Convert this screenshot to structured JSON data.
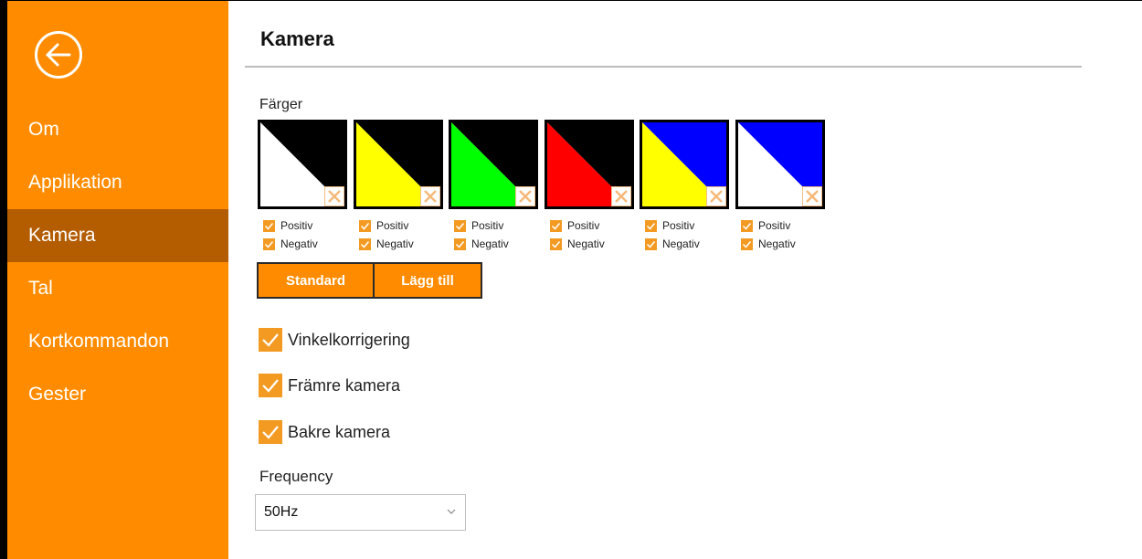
{
  "sidebar": {
    "back_icon": "back-arrow-circle-icon",
    "items": [
      {
        "label": "Om",
        "active": false
      },
      {
        "label": "Applikation",
        "active": false
      },
      {
        "label": "Kamera",
        "active": true
      },
      {
        "label": "Tal",
        "active": false
      },
      {
        "label": "Kortkommandon",
        "active": false
      },
      {
        "label": "Gester",
        "active": false
      }
    ],
    "color": "#ff8c00",
    "active_color": "#b35c00"
  },
  "page": {
    "title": "Kamera"
  },
  "colors_section": {
    "label": "Färger",
    "swatches": [
      {
        "top": "#000000",
        "bottom": "#ffffff",
        "positive": "Positiv",
        "negative": "Negativ",
        "positive_checked": true,
        "negative_checked": true
      },
      {
        "top": "#000000",
        "bottom": "#ffff00",
        "positive": "Positiv",
        "negative": "Negativ",
        "positive_checked": true,
        "negative_checked": true
      },
      {
        "top": "#000000",
        "bottom": "#00ff00",
        "positive": "Positiv",
        "negative": "Negativ",
        "positive_checked": true,
        "negative_checked": true
      },
      {
        "top": "#000000",
        "bottom": "#ff0000",
        "positive": "Positiv",
        "negative": "Negativ",
        "positive_checked": true,
        "negative_checked": true
      },
      {
        "top": "#0000ff",
        "bottom": "#ffff00",
        "positive": "Positiv",
        "negative": "Negativ",
        "positive_checked": true,
        "negative_checked": true
      },
      {
        "top": "#0000ff",
        "bottom": "#ffffff",
        "positive": "Positiv",
        "negative": "Negativ",
        "positive_checked": true,
        "negative_checked": true
      }
    ],
    "delete_icon": "close-x-icon"
  },
  "buttons": {
    "standard": "Standard",
    "add": "Lägg till"
  },
  "options": [
    {
      "label": "Vinkelkorrigering",
      "checked": true
    },
    {
      "label": "Främre kamera",
      "checked": true
    },
    {
      "label": "Bakre kamera",
      "checked": true
    }
  ],
  "frequency": {
    "label": "Frequency",
    "selected": "50Hz"
  },
  "accent": "#f39a22"
}
